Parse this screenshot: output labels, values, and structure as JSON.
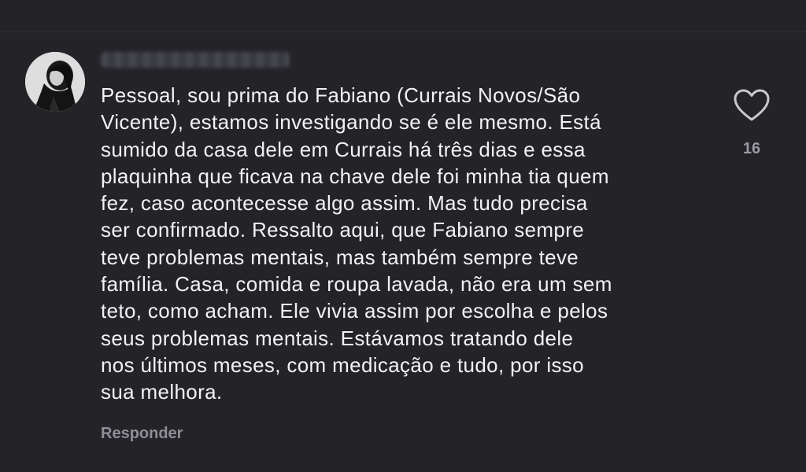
{
  "comment": {
    "avatar_icon": "user-avatar-photo",
    "text": "Pessoal, sou prima do Fabiano (Currais Novos/São\nVicente), estamos investigando se é ele mesmo. Está\nsumido da casa dele em Currais há três dias e essa\nplaquinha que ficava na chave dele foi minha tia quem\nfez, caso acontecesse algo assim. Mas tudo precisa\nser confirmado. Ressalto aqui, que Fabiano sempre\nteve problemas mentais, mas também sempre teve\nfamília. Casa, comida e roupa lavada, não era um sem\nteto, como acham. Ele vivia assim por escolha e pelos\nseus problemas mentais. Estávamos tratando dele\nnos últimos meses, com medicação e tudo, por isso\nsua melhora.",
    "reply_label": "Responder",
    "like_icon": "heart-outline-icon",
    "like_count": "16"
  },
  "colors": {
    "background": "#232328",
    "text_primary": "#f2f2f4",
    "text_secondary": "#8e8e96",
    "icon": "#c8c8cd"
  }
}
